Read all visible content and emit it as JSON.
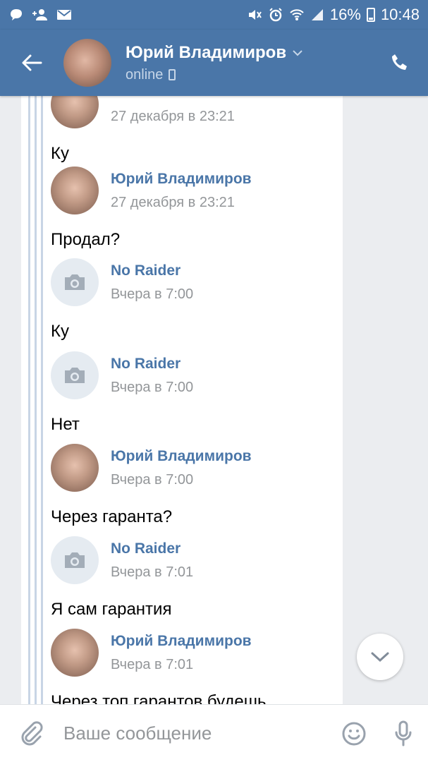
{
  "status_bar": {
    "battery": "16%",
    "time": "10:48",
    "left_icons": [
      "message-icon",
      "add-contact-icon",
      "mail-icon"
    ],
    "right_icons": [
      "mute-icon",
      "alarm-icon",
      "wifi-icon",
      "signal-icon",
      "battery-icon"
    ]
  },
  "header": {
    "name": "Юрий Владимиров",
    "status": "online",
    "accent": "#4a76a8"
  },
  "messages": [
    {
      "name": "",
      "time": "27 декабря в 23:21",
      "text": "Ку",
      "avatar": "photo"
    },
    {
      "name": "Юрий Владимиров",
      "time": "27 декабря в 23:21",
      "text": "Продал?",
      "avatar": "photo"
    },
    {
      "name": "No Raider",
      "time": "Вчера в 7:00",
      "text": "Ку",
      "avatar": "camera"
    },
    {
      "name": "No Raider",
      "time": "Вчера в 7:00",
      "text": "Нет",
      "avatar": "camera"
    },
    {
      "name": "Юрий Владимиров",
      "time": "Вчера в 7:00",
      "text": "Через гаранта?",
      "avatar": "photo"
    },
    {
      "name": "No Raider",
      "time": "Вчера в 7:01",
      "text": "Я сам гарантия",
      "avatar": "camera"
    },
    {
      "name": "Юрий Владимиров",
      "time": "Вчера в 7:01",
      "text": "Через топ гарантов будешь",
      "avatar": "photo"
    }
  ],
  "input": {
    "placeholder": "Ваше сообщение"
  }
}
